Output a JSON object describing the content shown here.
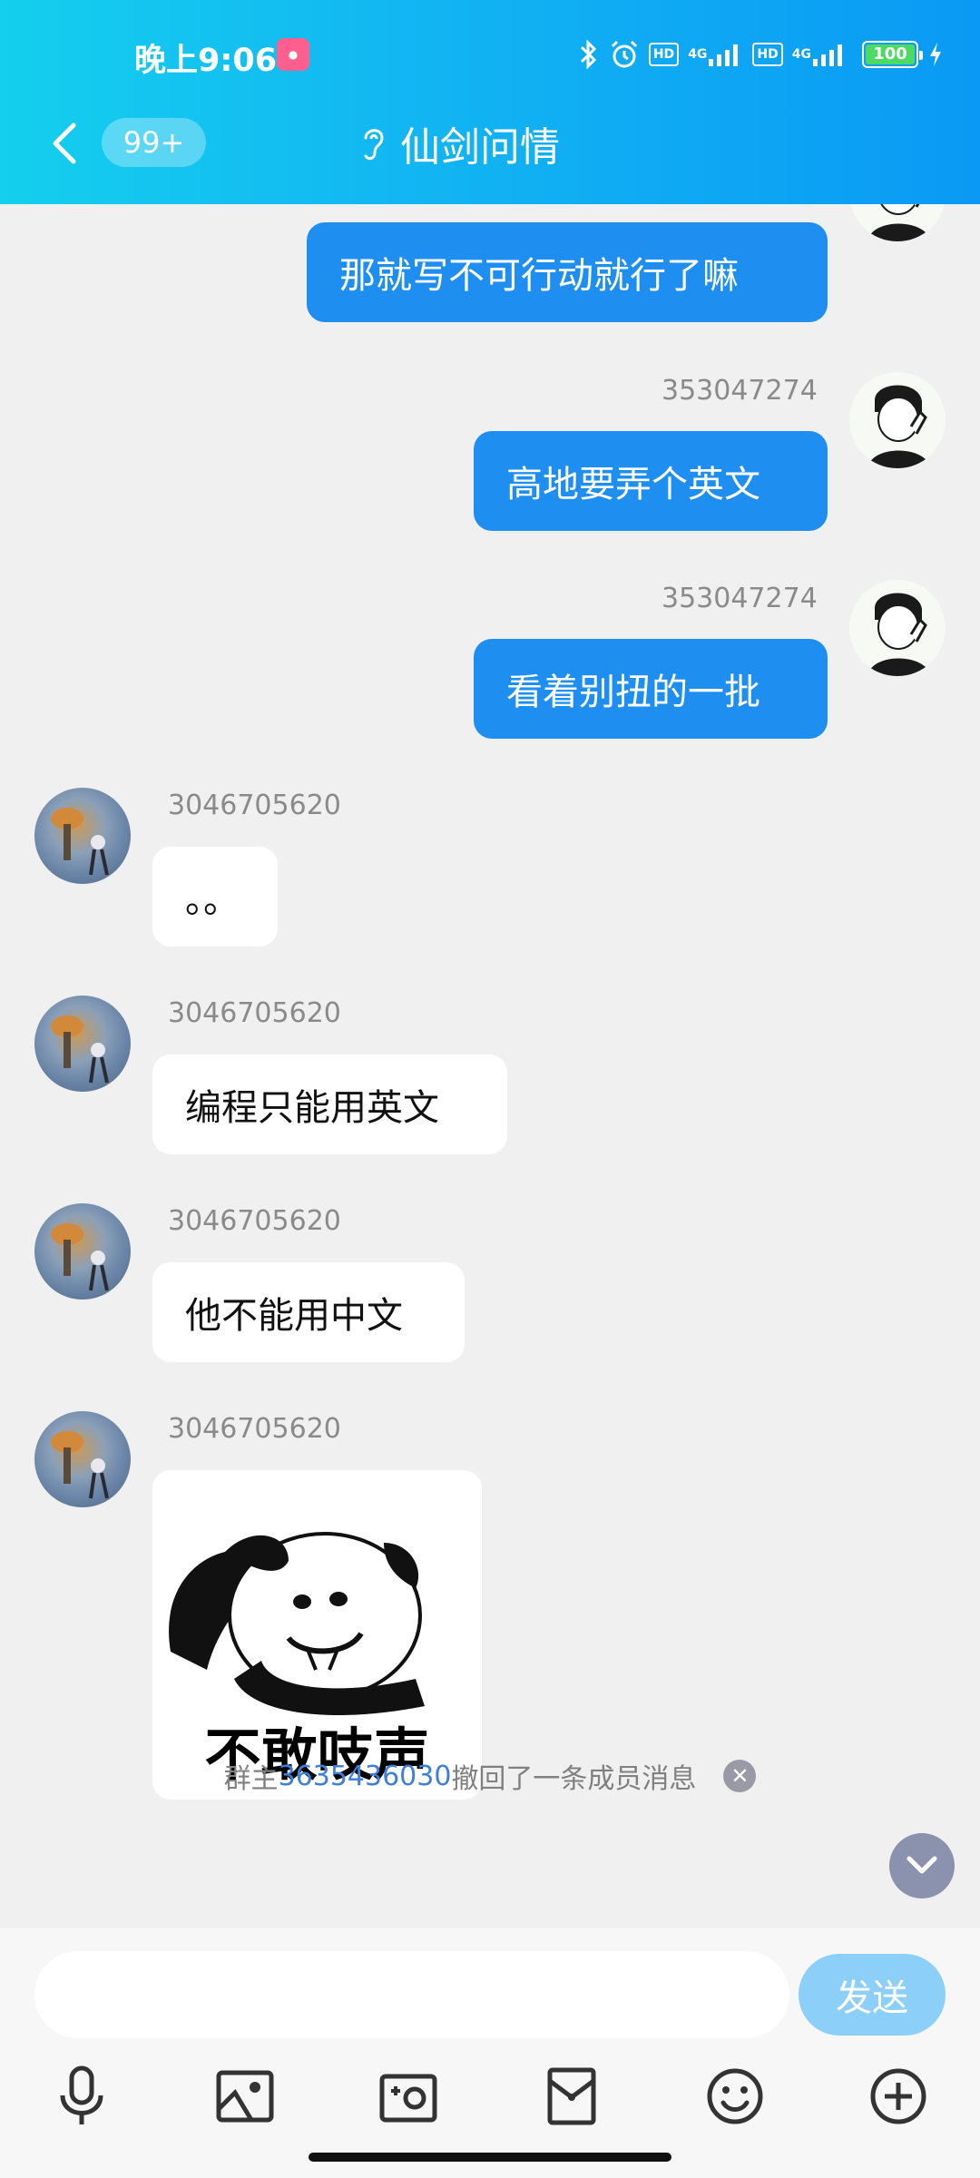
{
  "status_bar": {
    "time": "晚上9:06",
    "hd": "HD",
    "network": "4G",
    "battery": "100",
    "battery_level": 1.0
  },
  "header": {
    "unread_count": "99+",
    "title": "仙剑问情"
  },
  "messages": [
    {
      "side": "right",
      "sender": "",
      "text": "那就写不可行动就行了嘛"
    },
    {
      "side": "right",
      "sender": "353047274",
      "text": "高地要弄个英文"
    },
    {
      "side": "right",
      "sender": "353047274",
      "text": "看着别扭的一批"
    },
    {
      "side": "left",
      "sender": "3046705620",
      "text": "。。"
    },
    {
      "side": "left",
      "sender": "3046705620",
      "text": "编程只能用英文"
    },
    {
      "side": "left",
      "sender": "3046705620",
      "text": "他不能用中文"
    },
    {
      "side": "left",
      "sender": "3046705620",
      "sticker_text": "不敢吱声"
    }
  ],
  "system_message": {
    "prefix": "群主",
    "user_id": "3635436030",
    "suffix": "撤回了一条成员消息"
  },
  "composer": {
    "placeholder": "",
    "send_label": "发送"
  },
  "toolbar": [
    "mic-icon",
    "image-icon",
    "camera-icon",
    "file-icon",
    "emoji-icon",
    "plus-icon"
  ],
  "colors": {
    "header_start": "#14cfee",
    "header_end": "#0a9af5",
    "bubble_me": "#1e8ef0",
    "bubble_other": "#ffffff",
    "link": "#3f7fd8",
    "send_button": "#8ccff8"
  }
}
